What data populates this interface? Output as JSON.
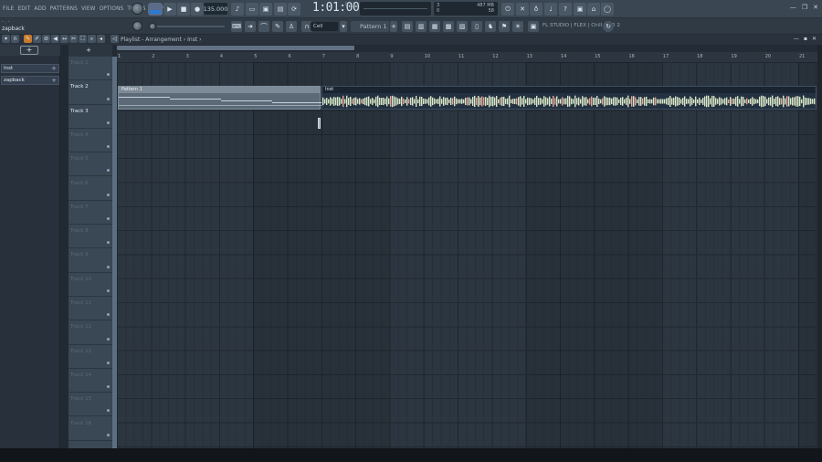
{
  "menus": [
    "FILE",
    "EDIT",
    "ADD",
    "PATTERNS",
    "VIEW",
    "OPTIONS",
    "TOOLS",
    "HELP"
  ],
  "transport": {
    "mode": "SONG",
    "tempo": "135.000",
    "time": "1:01:00",
    "time_label": "B:S:T",
    "cpu_left": "3\n0",
    "mem": "487 MB\n58"
  },
  "toolbar2": {
    "hint": "- . -",
    "focus_name": "zapback",
    "snap": "Cell",
    "pattern": "Pattern 1",
    "news": "FL STUDIO | FLEX | Chill Lo-Fi 2"
  },
  "playlist": {
    "title": "Playlist - Arrangement › Inst ›"
  },
  "picker": {
    "items": [
      "Inst",
      "zapback"
    ]
  },
  "tracks": [
    "Track 1",
    "Track 2",
    "Track 3",
    "Track 4",
    "Track 5",
    "Track 6",
    "Track 7",
    "Track 8",
    "Track 9",
    "Track 10",
    "Track 11",
    "Track 12",
    "Track 13",
    "Track 14",
    "Track 15",
    "Track 16"
  ],
  "ruler": [
    "1",
    "2",
    "3",
    "4",
    "5",
    "6",
    "7",
    "8",
    "9",
    "10",
    "11",
    "12",
    "13",
    "14",
    "15",
    "16",
    "17",
    "18",
    "19",
    "20",
    "21"
  ],
  "clips": {
    "pattern_label": "Pattern 1",
    "audio_label": "Inst"
  },
  "colors": {
    "accent": "#2a7ad4",
    "audio_wave": "#d9e8c8"
  }
}
